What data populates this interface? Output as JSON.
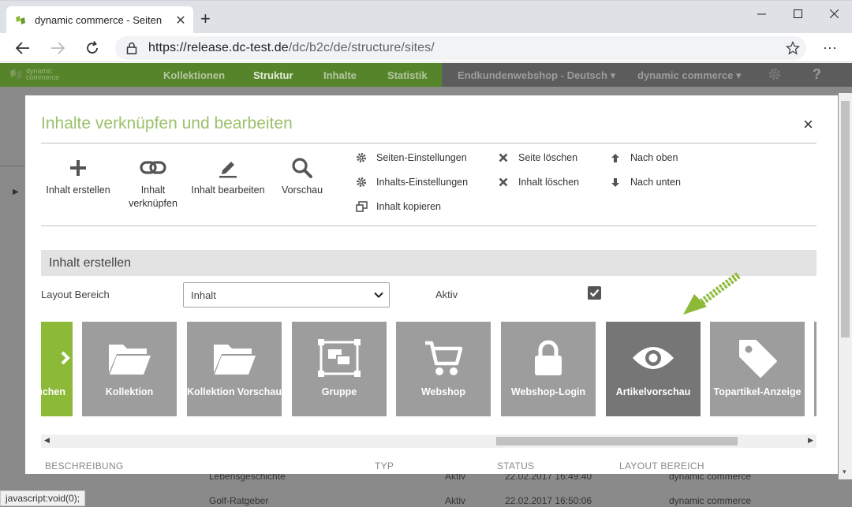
{
  "browser": {
    "tab_title": "dynamic commerce - Seiten",
    "new_tab": "+",
    "url_host": "https://release.dc-test.de",
    "url_path": "/dc/b2c/de/structure/sites/",
    "status_text": "javascript:void(0);"
  },
  "app": {
    "logo_line1": "dynamic",
    "logo_line2": "commerce",
    "nav": [
      "Kollektionen",
      "Struktur",
      "Inhalte",
      "Statistik"
    ],
    "shop_select": "Endkundenwebshop - Deutsch",
    "company_select": "dynamic commerce"
  },
  "background_rows": [
    {
      "name": "Lebensgeschichte",
      "status": "Aktiv",
      "date": "22.02.2017 16:49:40",
      "area": "dynamic commerce"
    },
    {
      "name": "Golf-Ratgeber",
      "status": "Aktiv",
      "date": "22.02.2017 16:50:06",
      "area": "dynamic commerce"
    }
  ],
  "modal": {
    "title": "Inhalte verknüpfen und bearbeiten",
    "close": "×",
    "tools": [
      {
        "icon": "plus-icon",
        "label": "Inhalt erstellen"
      },
      {
        "icon": "link-icon",
        "label": "Inhalt verknüpfen"
      },
      {
        "icon": "edit-icon",
        "label": "Inhalt bearbeiten"
      },
      {
        "icon": "search-icon",
        "label": "Vorschau"
      }
    ],
    "actions": {
      "site_settings": "Seiten-Einstellungen",
      "content_settings": "Inhalts-Einstellungen",
      "copy_content": "Inhalt kopieren",
      "delete_site": "Seite löschen",
      "delete_content": "Inhalt löschen",
      "move_up": "Nach oben",
      "move_down": "Nach unten"
    },
    "section_title": "Inhalt erstellen",
    "layout_label": "Layout Bereich",
    "layout_value": "Inhalt",
    "active_label": "Aktiv",
    "active_checked": true,
    "tiles": [
      {
        "label": "uchen",
        "icon": "chevron-icon"
      },
      {
        "label": "Kollektion",
        "icon": "folder-icon"
      },
      {
        "label": "Kollektion Vorschau",
        "icon": "folder-icon"
      },
      {
        "label": "Gruppe",
        "icon": "group-icon"
      },
      {
        "label": "Webshop",
        "icon": "cart-icon"
      },
      {
        "label": "Webshop-Login",
        "icon": "lock-icon"
      },
      {
        "label": "Artikelvorschau",
        "icon": "eye-icon"
      },
      {
        "label": "Topartikel-Anzeige",
        "icon": "tag-icon"
      }
    ],
    "columns": [
      "BESCHREIBUNG",
      "TYP",
      "STATUS",
      "LAYOUT BEREICH"
    ]
  },
  "colors": {
    "accent_green": "#8cba38",
    "title_green": "#9bc16c",
    "tile_grey": "#9d9d9d",
    "tile_selected": "#767676"
  }
}
